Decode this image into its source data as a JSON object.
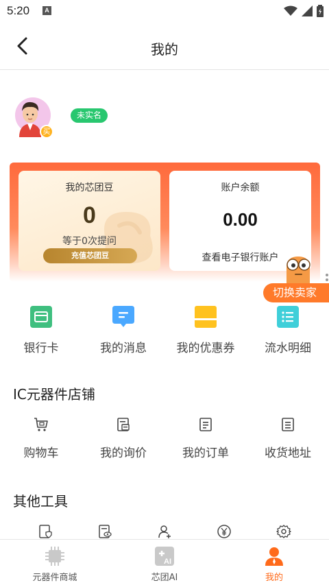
{
  "status_bar": {
    "time": "5:20",
    "notification": "A"
  },
  "header": {
    "title": "我的"
  },
  "profile": {
    "role_badge": "买",
    "realname_tag": "未实名"
  },
  "wallet": {
    "beans": {
      "title": "我的芯团豆",
      "value": "0",
      "withdraw_text": "等于0次提问",
      "recharge_label": "充值芯团豆"
    },
    "balance": {
      "title": "账户余额",
      "value": "0.00",
      "link_label": "查看电子银行账户"
    }
  },
  "switch_seller_label": "切换卖家",
  "quick_actions": [
    {
      "label": "银行卡",
      "icon": "bank-card-icon",
      "color": "#3fbf7f"
    },
    {
      "label": "我的消息",
      "icon": "message-icon",
      "color": "#4aa8ff"
    },
    {
      "label": "我的优惠券",
      "icon": "coupon-icon",
      "color": "#ffc21f"
    },
    {
      "label": "流水明细",
      "icon": "statement-icon",
      "color": "#3fcfd9"
    }
  ],
  "shop_section": {
    "title": "IC元器件店铺",
    "items": [
      {
        "label": "购物车",
        "icon": "cart-icon"
      },
      {
        "label": "我的询价",
        "icon": "inquiry-icon"
      },
      {
        "label": "我的订单",
        "icon": "order-icon"
      },
      {
        "label": "收货地址",
        "icon": "address-icon"
      }
    ]
  },
  "tools_section": {
    "title": "其他工具",
    "icons": [
      "document-shield-icon",
      "document-eye-icon",
      "user-add-icon",
      "yuan-icon",
      "settings-icon"
    ]
  },
  "tab_bar": {
    "tabs": [
      {
        "label": "元器件商城",
        "icon": "chip-icon"
      },
      {
        "label": "芯团AI",
        "icon": "ai-icon"
      },
      {
        "label": "我的",
        "icon": "profile-icon"
      }
    ],
    "active_color": "#ff6a1a"
  }
}
